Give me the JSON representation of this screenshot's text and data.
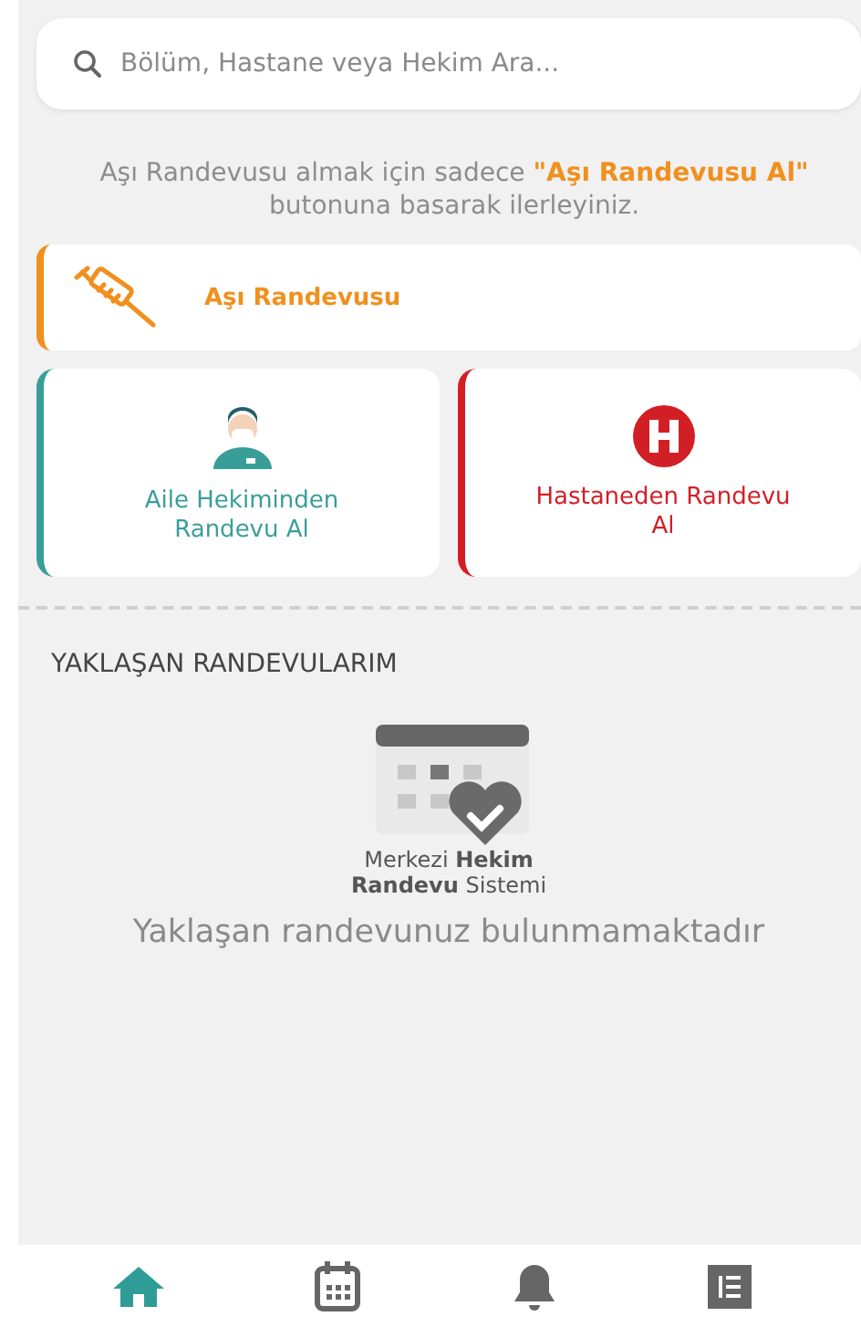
{
  "search": {
    "placeholder": "Bölüm, Hastane veya Hekim Ara..."
  },
  "notice": "Aşı Randevusu almak için sadece **\"Aşı Randevusu Al\"** butonuna basarak ilerleyiniz.",
  "vaccine_card": {
    "label": "Aşı Randevusu",
    "color": "#f0901e"
  },
  "cards": [
    {
      "kind": "doctor",
      "label": "Aile Hekiminden Randevu Al",
      "color": "#3a9e98"
    },
    {
      "kind": "hospital",
      "label": "Hastaneden Randevu Al",
      "color": "#d21f26"
    }
  ],
  "section_title": "YAKLAŞAN RANDEVULARIM",
  "logo_lines": [
    "Merkezi **Hekim**",
    "**Randevu** Sistemi"
  ],
  "empty_message": "Yaklaşan randevunuz bulunmamaktadır",
  "bottom_nav": [
    {
      "kind": "home",
      "selected": true
    },
    {
      "kind": "calendar",
      "selected": false
    },
    {
      "kind": "bell",
      "selected": false
    },
    {
      "kind": "menu",
      "selected": false
    }
  ]
}
